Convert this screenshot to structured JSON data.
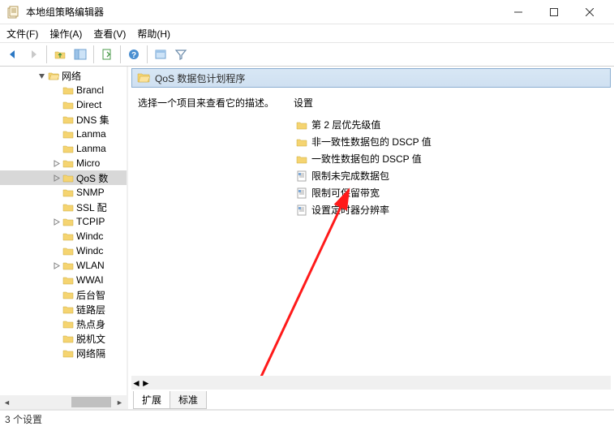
{
  "window": {
    "title": "本地组策略编辑器",
    "menus": {
      "file": "文件(F)",
      "action": "操作(A)",
      "view": "查看(V)",
      "help": "帮助(H)"
    }
  },
  "tree": {
    "rootLabel": "网络",
    "items": [
      {
        "label": "Brancl",
        "expandable": false
      },
      {
        "label": "Direct",
        "expandable": false
      },
      {
        "label": "DNS 集",
        "expandable": false
      },
      {
        "label": "Lanma",
        "expandable": false
      },
      {
        "label": "Lanma",
        "expandable": false
      },
      {
        "label": "Micro",
        "expandable": true
      },
      {
        "label": "QoS 数",
        "expandable": true,
        "selected": true
      },
      {
        "label": "SNMP",
        "expandable": false
      },
      {
        "label": "SSL 配",
        "expandable": false
      },
      {
        "label": "TCPIP",
        "expandable": true
      },
      {
        "label": "Windc",
        "expandable": false
      },
      {
        "label": "Windc",
        "expandable": false
      },
      {
        "label": "WLAN",
        "expandable": true
      },
      {
        "label": "WWAI",
        "expandable": false
      },
      {
        "label": "后台智",
        "expandable": false
      },
      {
        "label": "链路层",
        "expandable": false
      },
      {
        "label": "热点身",
        "expandable": false
      },
      {
        "label": "脱机文",
        "expandable": false
      },
      {
        "label": "网络隔",
        "expandable": false
      }
    ]
  },
  "header": {
    "title": "QoS 数据包计划程序"
  },
  "detail": {
    "hint": "选择一个项目来查看它的描述。",
    "settingsHeader": "设置",
    "items": [
      {
        "type": "folder",
        "label": "第 2 层优先级值"
      },
      {
        "type": "folder",
        "label": "非一致性数据包的 DSCP 值"
      },
      {
        "type": "folder",
        "label": "一致性数据包的 DSCP 值"
      },
      {
        "type": "setting",
        "label": "限制未完成数据包"
      },
      {
        "type": "setting",
        "label": "限制可保留带宽"
      },
      {
        "type": "setting",
        "label": "设置定时器分辨率"
      }
    ]
  },
  "tabs": {
    "ext": "扩展",
    "std": "标准"
  },
  "status": "3 个设置"
}
